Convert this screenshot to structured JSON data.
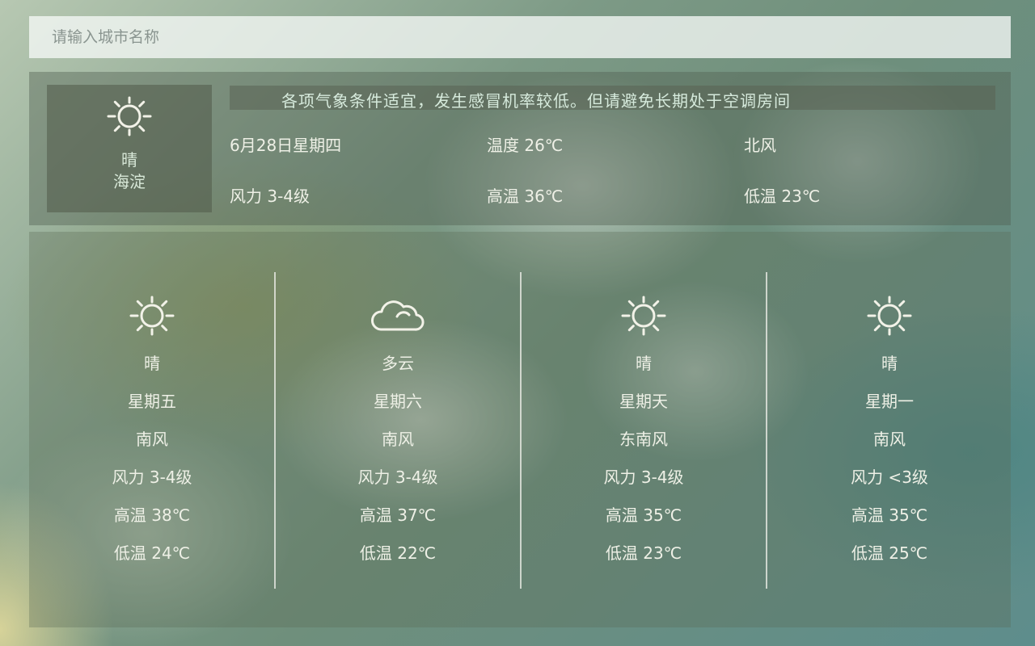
{
  "search": {
    "placeholder": "请输入城市名称"
  },
  "today": {
    "tips": "各项气象条件适宜，发生感冒机率较低。但请避免长期处于空调房间",
    "icon": "sun-icon",
    "condition": "晴",
    "city": "海淀",
    "date": "6月28日星期四",
    "temperature": "温度 26℃",
    "wind_direction": "北风",
    "wind_force": "风力 3-4级",
    "high": "高温 36℃",
    "low": "低温 23℃"
  },
  "forecast": [
    {
      "icon": "sun-icon",
      "condition": "晴",
      "weekday": "星期五",
      "wind_direction": "南风",
      "wind_force": "风力 3-4级",
      "high": "高温 38℃",
      "low": "低温 24℃"
    },
    {
      "icon": "cloud-icon",
      "condition": "多云",
      "weekday": "星期六",
      "wind_direction": "南风",
      "wind_force": "风力 3-4级",
      "high": "高温 37℃",
      "low": "低温 22℃"
    },
    {
      "icon": "sun-icon",
      "condition": "晴",
      "weekday": "星期天",
      "wind_direction": "东南风",
      "wind_force": "风力 3-4级",
      "high": "高温 35℃",
      "low": "低温 23℃"
    },
    {
      "icon": "sun-icon",
      "condition": "晴",
      "weekday": "星期一",
      "wind_direction": "南风",
      "wind_force": "风力 <3级",
      "high": "高温 35℃",
      "low": "低温 25℃"
    }
  ]
}
